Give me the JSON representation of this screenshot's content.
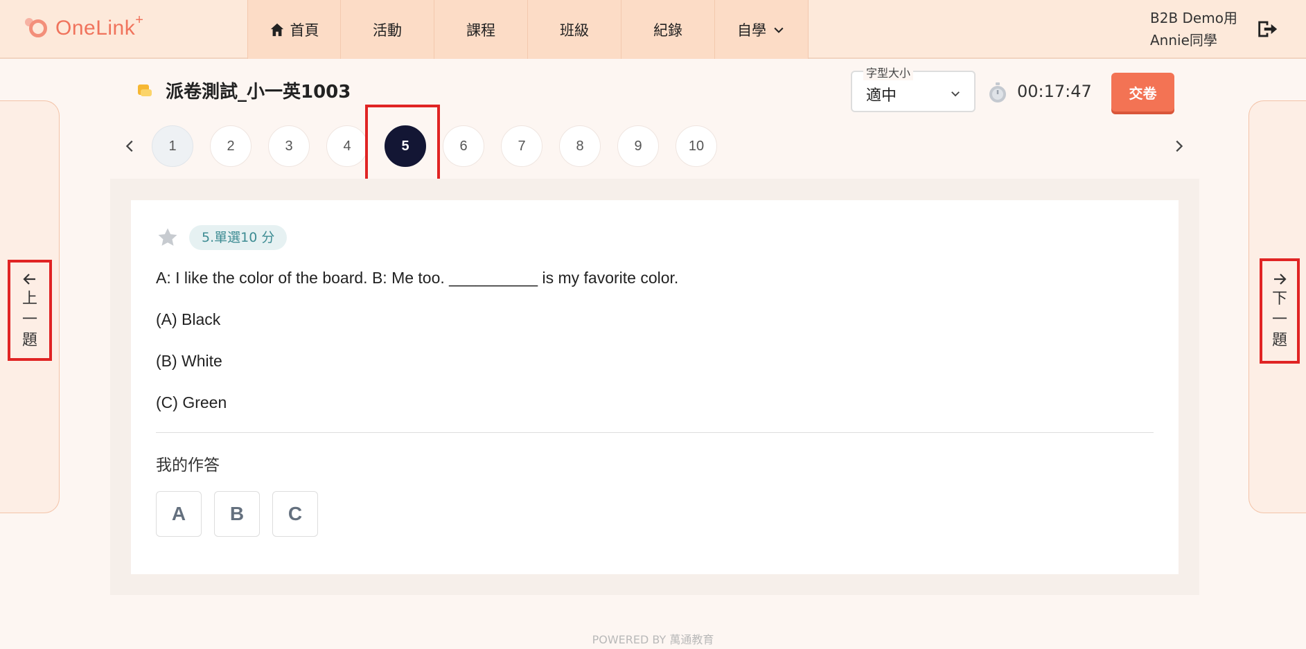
{
  "header": {
    "logo_text": "OneLink",
    "logo_plus": "+",
    "nav": [
      {
        "label": "首頁",
        "icon": "home-icon"
      },
      {
        "label": "活動"
      },
      {
        "label": "課程"
      },
      {
        "label": "班級"
      },
      {
        "label": "紀錄"
      },
      {
        "label": "自學",
        "icon": "chevron-down-icon"
      }
    ],
    "user": {
      "org": "B2B Demo用",
      "name": "Annie同學"
    },
    "logout_icon": "logout-icon"
  },
  "exam": {
    "title": "派卷測試_小一英1003",
    "font_size": {
      "legend": "字型大小",
      "value": "適中"
    },
    "timer": "00:17:47",
    "submit_label": "交卷"
  },
  "pager": {
    "pages": [
      "1",
      "2",
      "3",
      "4",
      "5",
      "6",
      "7",
      "8",
      "9",
      "10"
    ],
    "current": "5",
    "visited": [
      "1"
    ]
  },
  "side": {
    "prev_chars": [
      "上",
      "一",
      "題"
    ],
    "next_chars": [
      "下",
      "一",
      "題"
    ]
  },
  "question": {
    "badge": "5.單選10 分",
    "text": "A: I like the color of the board. B: Me too. __________ is my favorite color.",
    "options": [
      "(A) Black",
      "(B) White",
      "(C) Green"
    ],
    "answer_label": "我的作答",
    "answer_choices": [
      "A",
      "B",
      "C"
    ]
  },
  "footer": {
    "text": "POWERED BY 萬通教育"
  },
  "colors": {
    "accent": "#f37354",
    "active_page": "#131634",
    "highlight": "#e02424",
    "header_bg": "#fde9da"
  }
}
